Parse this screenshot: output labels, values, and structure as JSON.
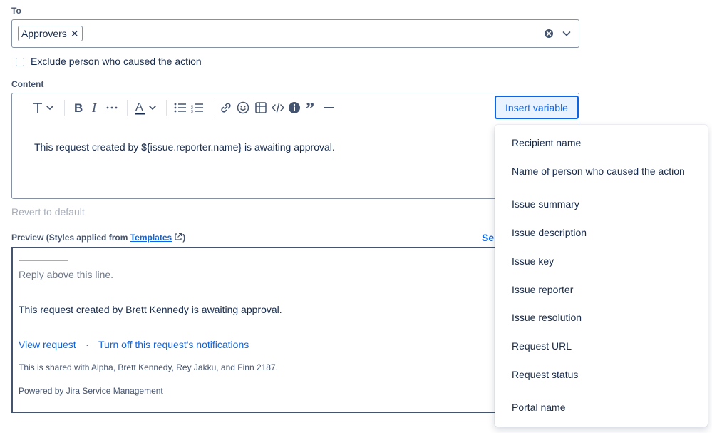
{
  "to": {
    "label": "To",
    "chip_label": "Approvers",
    "chip_remove": "✕"
  },
  "exclude_checkbox": {
    "label": "Exclude person who caused the action",
    "checked": false
  },
  "content": {
    "label": "Content",
    "body_text": "This request created by ${issue.reporter.name} is awaiting approval.",
    "insert_variable_label": "Insert variable",
    "toolbar_icons": [
      "text-style-icon",
      "bold-icon",
      "italic-icon",
      "more-formatting-icon",
      "text-color-icon",
      "bullet-list-icon",
      "numbered-list-icon",
      "link-icon",
      "emoji-icon",
      "table-icon",
      "code-icon",
      "info-panel-icon",
      "quote-icon",
      "divider-icon"
    ]
  },
  "revert_label": "Revert to default",
  "preview": {
    "label_prefix": "Preview (Styles applied from ",
    "templates_link": "Templates",
    "label_suffix": ")",
    "send_link": "Ser",
    "reply_line": "Reply above this line.",
    "body": "This request created by Brett Kennedy is awaiting approval.",
    "view_request": "View request",
    "separator": "·",
    "turn_off": "Turn off this request's notifications",
    "shared": "This is shared with Alpha, Brett Kennedy, Rey Jakku, and Finn 2187.",
    "powered": "Powered by Jira Service Management"
  },
  "menu": {
    "items": [
      "Recipient name",
      "Name of person who caused the action",
      "Issue summary",
      "Issue description",
      "Issue key",
      "Issue reporter",
      "Issue resolution",
      "Request URL",
      "Request status",
      "Portal name"
    ]
  },
  "colors": {
    "accent": "#0c66e4",
    "text": "#172b4d",
    "subtle": "#44546f",
    "border": "#8590a2"
  }
}
